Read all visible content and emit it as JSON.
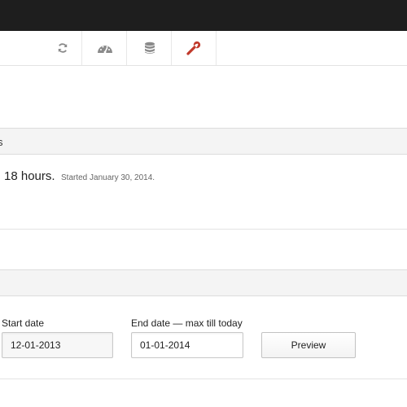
{
  "toolbar": {
    "icons": [
      "refresh-icon",
      "dashboard-gauge-icon",
      "database-icon",
      "wrench-icon"
    ],
    "colors": {
      "wrench": "#c0392b",
      "icon": "#8a8a8a"
    }
  },
  "uptime_panel": {
    "heading": "s",
    "duration": "18 hours.",
    "started": "Started January 30, 2014."
  },
  "range_panel": {
    "start_label": "Start date",
    "start_value": "12-01-2013",
    "end_label": "End date — max till today",
    "end_value": "01-01-2014",
    "preview_label": "Preview"
  }
}
